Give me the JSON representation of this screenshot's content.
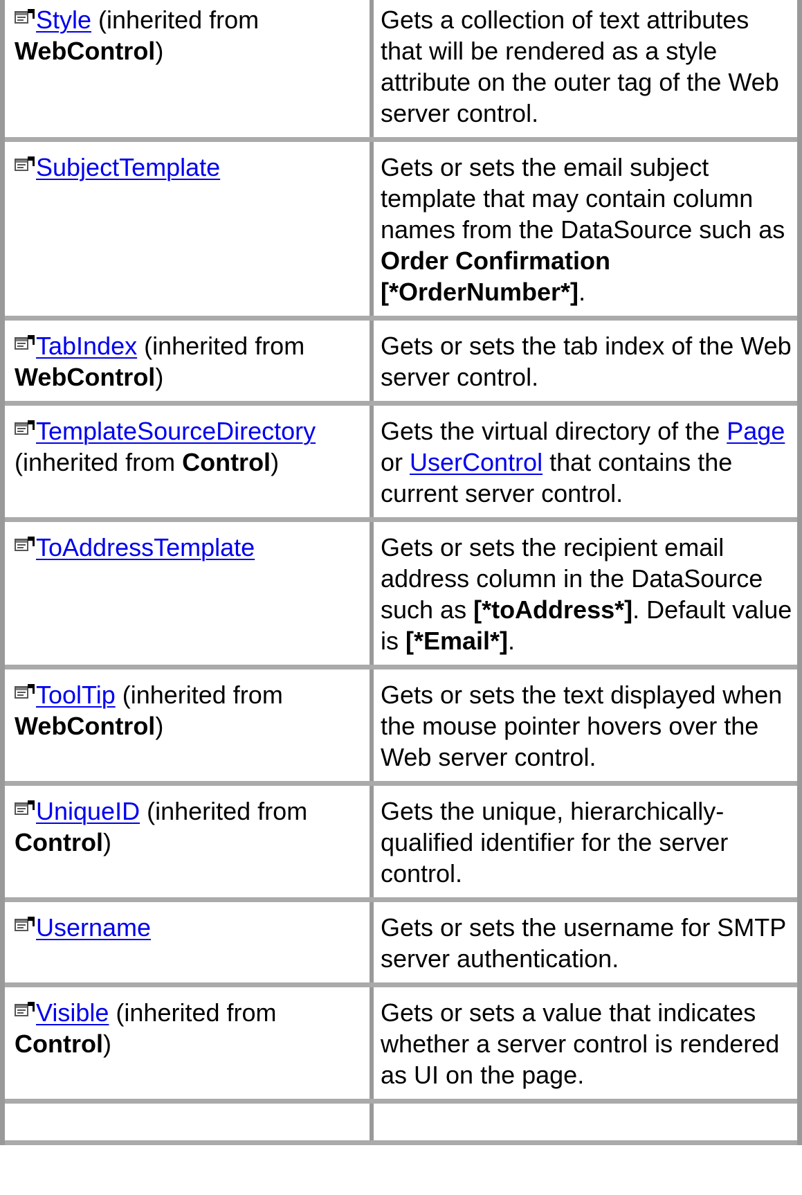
{
  "rows": [
    {
      "link": "Style",
      "inherited_prefix": " (inherited from ",
      "inherited_from": "WebControl",
      "inherited_suffix": ")",
      "description": "Gets a collection of text attributes that will be rendered as a style attribute on the outer tag of the Web server control."
    },
    {
      "link": "SubjectTemplate",
      "desc_part1": "Gets or sets the email subject template that may contain column names from the DataSource such as ",
      "desc_bold": "Order Confirmation [*OrderNumber*]",
      "desc_part2": "."
    },
    {
      "link": "TabIndex",
      "inherited_prefix": " (inherited from ",
      "inherited_from": "WebControl",
      "inherited_suffix": ")",
      "description": "Gets or sets the tab index of the Web server control."
    },
    {
      "link": "TemplateSourceDirectory",
      "inherited_prefix": " (inherited from ",
      "inherited_from": "Control",
      "inherited_suffix": ")",
      "desc_part1": "Gets the virtual directory of the ",
      "desc_link1": "Page",
      "desc_part2": " or ",
      "desc_link2": "UserControl",
      "desc_part3": " that contains the current server control."
    },
    {
      "link": "ToAddressTemplate",
      "desc_part1": "Gets or sets the recipient email address column in the DataSource such as ",
      "desc_bold1": "[*toAddress*]",
      "desc_part2": ". Default value is ",
      "desc_bold2": "[*Email*]",
      "desc_part3": "."
    },
    {
      "link": "ToolTip",
      "inherited_prefix": " (inherited from ",
      "inherited_from": "WebControl",
      "inherited_suffix": ")",
      "description": "Gets or sets the text displayed when the mouse pointer hovers over the Web server control."
    },
    {
      "link": "UniqueID",
      "inherited_prefix": " (inherited from ",
      "inherited_from": "Control",
      "inherited_suffix": ")",
      "description": "Gets the unique, hierarchically-qualified identifier for the server control."
    },
    {
      "link": "Username",
      "description": "Gets or sets the username for SMTP server authentication."
    },
    {
      "link": "Visible",
      "inherited_prefix": " (inherited from ",
      "inherited_from": "Control",
      "inherited_suffix": ")",
      "description": "Gets or sets a value that indicates whether a server control is rendered as UI on the page."
    }
  ],
  "icon": "property-icon",
  "colors": {
    "link": "#0000ee",
    "border": "#999999"
  }
}
